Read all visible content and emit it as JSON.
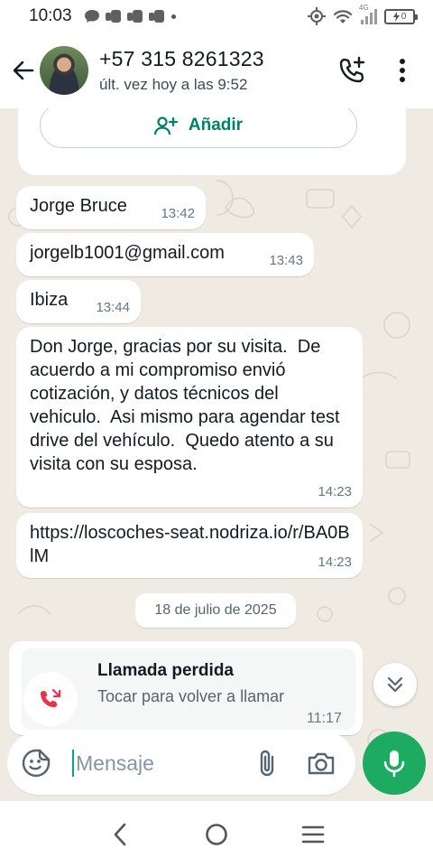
{
  "status_bar": {
    "time": "10:03",
    "network_label": "4G",
    "battery_level": "0"
  },
  "header": {
    "contact_name": "+57 315 8261323",
    "last_seen": "últ. vez hoy a las 9:52"
  },
  "add_contact": {
    "label": "Añadir"
  },
  "messages": [
    {
      "text": "Jorge Bruce",
      "time": "13:42"
    },
    {
      "text": "jorgelb1001@gmail.com",
      "time": "13:43"
    },
    {
      "text": "Ibiza",
      "time": "13:44"
    },
    {
      "text": "Don Jorge, gracias por su visita.  De acuerdo a mi compromiso envió cotización, y datos técnicos del vehiculo.  Asi mismo para agendar test drive del vehículo.  Quedo atento a su visita con su esposa.",
      "time": "14:23"
    },
    {
      "text": "https://loscoches-seat.nodriza.io/r/BA0BlM",
      "time": "14:23"
    }
  ],
  "date_separator": "18 de julio de 2025",
  "missed_call": {
    "title": "Llamada perdida",
    "subtitle": "Tocar para volver a llamar",
    "time": "11:17"
  },
  "composer": {
    "placeholder": "Mensaje"
  },
  "icons": {
    "back": "arrow-left-icon",
    "add_call": "phone-plus-icon",
    "menu": "more-vert-icon",
    "add_contact": "person-add-icon",
    "missed_call": "phone-missed-icon",
    "scroll_down": "chevron-double-down-icon",
    "sticker": "sticker-smile-icon",
    "attach": "paperclip-icon",
    "camera": "camera-icon",
    "mic": "microphone-icon"
  },
  "colors": {
    "accent_green": "#008069",
    "mic_green": "#1daa61",
    "missed_red": "#e8324a",
    "chat_bg": "#efeae2"
  }
}
